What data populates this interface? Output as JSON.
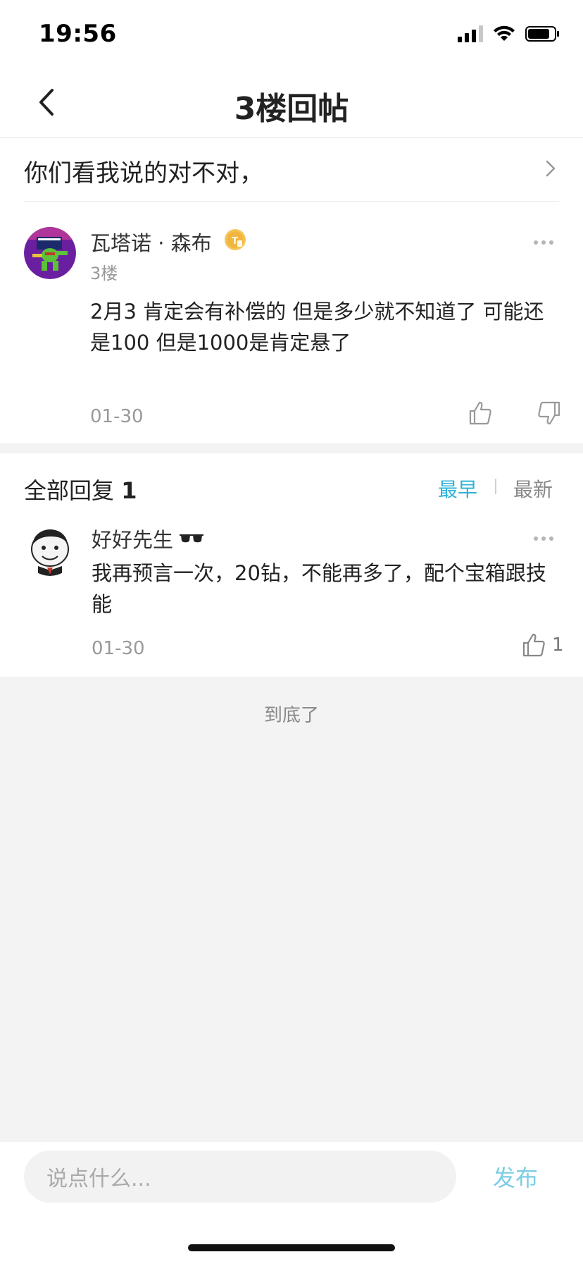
{
  "status_bar": {
    "time": "19:56"
  },
  "nav": {
    "title": "3楼回帖"
  },
  "topic": {
    "text": "你们看我说的对不对，"
  },
  "post": {
    "author": "瓦塔诺 · 森布",
    "floor": "3楼",
    "content": "2月3 肯定会有补偿的 但是多少就不知道了 可能还是100  但是1000是肯定悬了",
    "date": "01-30"
  },
  "replies": {
    "title_prefix": "全部回复",
    "count": "1",
    "sort_earliest": "最早",
    "sort_newest": "最新",
    "items": [
      {
        "author": "好好先生",
        "content": "我再预言一次，20钻，不能再多了，配个宝箱跟技能",
        "date": "01-30",
        "like_count": "1"
      }
    ]
  },
  "end_text": "到底了",
  "bottom": {
    "input_placeholder": "说点什么...",
    "publish_label": "发布"
  },
  "colors": {
    "accent": "#2bb3d6",
    "publish": "#7dcde4"
  }
}
